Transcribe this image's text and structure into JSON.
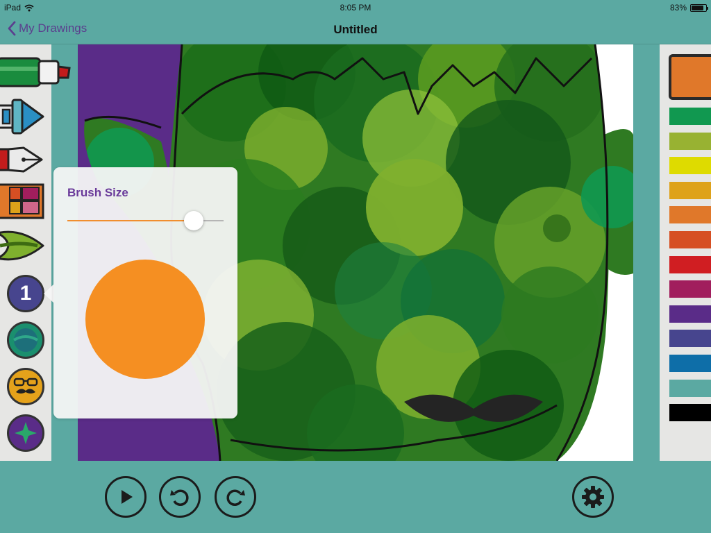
{
  "status_bar": {
    "device": "iPad",
    "time": "8:05 PM",
    "battery": "83%",
    "battery_level": 0.83
  },
  "nav": {
    "back_label": "My Drawings",
    "title": "Untitled"
  },
  "tools": [
    {
      "name": "marker-tool",
      "color": "#1a8c3e"
    },
    {
      "name": "crayon-tool",
      "color": "#2a8fc4"
    },
    {
      "name": "fountain-pen-tool",
      "color": "#c21c1c"
    },
    {
      "name": "stamp-palette-tool",
      "color": "#e0782a"
    },
    {
      "name": "paint-brush-tool",
      "color": "#7fb02e"
    }
  ],
  "brushes": [
    {
      "name": "number-brush",
      "glyph": "1",
      "color": "#47458e",
      "selected": true
    },
    {
      "name": "pattern-brush",
      "color": "#1a8f6e"
    },
    {
      "name": "mustache-brush",
      "color": "#e5a21b"
    },
    {
      "name": "sparkle-brush",
      "color": "#5a2c88"
    }
  ],
  "popover": {
    "title": "Brush Size",
    "brush_size": 0.81,
    "preview_color": "#f58f22"
  },
  "palette": {
    "current_color": "#e0782a",
    "colors": [
      "#119850",
      "#98b232",
      "#dedb00",
      "#dea21a",
      "#e0782a",
      "#d64f23",
      "#d01e22",
      "#a11e5d",
      "#5a2c88",
      "#47458e",
      "#0e6ea8",
      "#5ba9a2",
      "#000000"
    ]
  },
  "controls": {
    "play": "play-button",
    "undo": "undo-button",
    "redo": "redo-button",
    "settings": "settings-button"
  },
  "colors": {
    "background": "#5ba9a2",
    "canvas_background": "#5a2c88",
    "accent": "#6a3a9a"
  }
}
